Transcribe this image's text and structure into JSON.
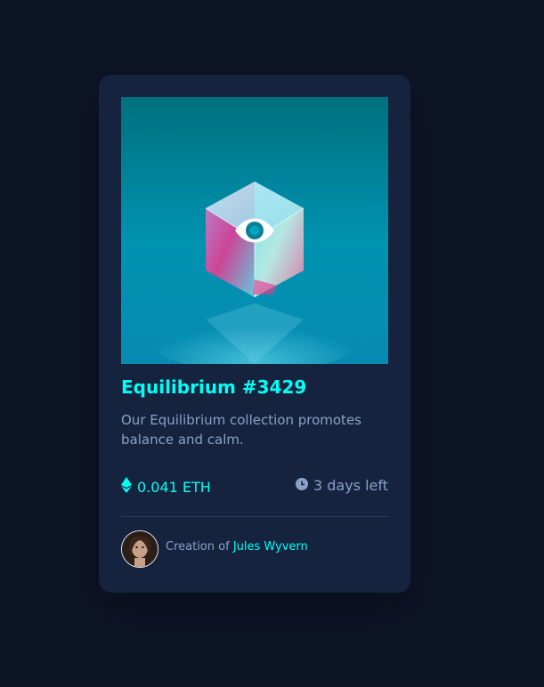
{
  "card": {
    "title": "Equilibrium #3429",
    "description": "Our Equilibrium collection promotes balance and calm.",
    "price": "0.041 ETH",
    "time_left": "3 days left",
    "creator_prefix": "Creation of",
    "creator_name": "Jules Wyvern"
  },
  "colors": {
    "background": "#0d1426",
    "card": "#15233e",
    "accent_cyan": "#00fff7",
    "muted_text": "#8ba0c7",
    "divider": "#2e3d5c"
  },
  "icons": {
    "overlay": "eye-icon",
    "price": "ethereum-icon",
    "time": "clock-icon"
  }
}
